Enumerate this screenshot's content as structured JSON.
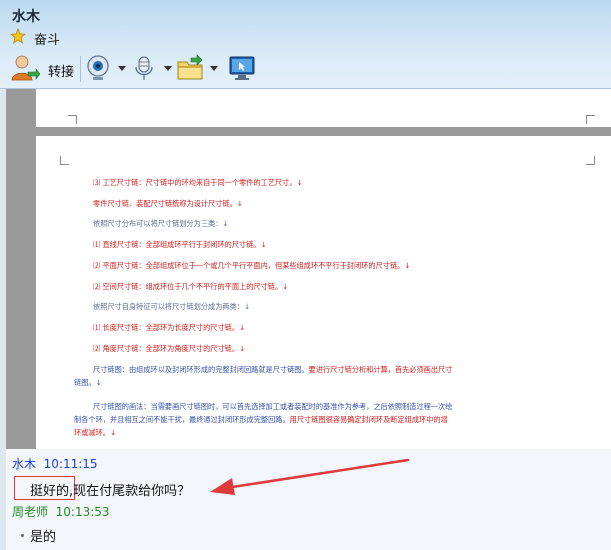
{
  "header": {
    "contact_name": "水木",
    "signature": "奋斗",
    "toolbar": {
      "transfer_label": "转接"
    }
  },
  "document": {
    "lines": [
      {
        "text": "⑶ 工艺尺寸链：尺寸链中的环均来自于同一个零件的工艺尺寸。↓",
        "color": "red"
      },
      {
        "text": "零件尺寸链、装配尺寸链统称为设计尺寸链。↓",
        "color": "red"
      },
      {
        "text": "依照尺寸分布可以将尺寸链划分为三类：↓",
        "color": "gray"
      },
      {
        "text": "⑴ 直线尺寸链：全部组成环平行于封闭环的尺寸链。↓",
        "color": "red"
      },
      {
        "text": "⑵ 平面尺寸链：全部组成环位于一个或几个平行平面内，但某些组成环不平行于封闭环的尺寸链。↓",
        "color": "red"
      },
      {
        "text": "⑵ 空间尺寸链：组成环位于几个不平行的平面上的尺寸链。↓",
        "color": "red"
      },
      {
        "text": "依照尺寸自身特征可以将尺寸链划分成为两类：↓",
        "color": "gray"
      },
      {
        "text": "⑴ 长度尺寸链：全部环为长度尺寸的尺寸链。↓",
        "color": "red"
      },
      {
        "text": "⑵ 角度尺寸链：全部环为角度尺寸的尺寸链。↓",
        "color": "red"
      }
    ],
    "para1": {
      "blue": "尺寸链图：由组成环以及封闭环形成的完整封闭回路就是尺寸链图。",
      "red": "要进行尺寸链分析和计算，首先必须画出尺寸",
      "line2": "链图。↓"
    },
    "para2": {
      "line1": "尺寸链图的画法：当需要画尺寸链图时，可以首先选择加工或者装配时的基准作为参考，之后依照制造过程一次绘",
      "line2_blue": "制各个环，并且相互之间不能干扰，最终通过封闭环形成完整回路。",
      "line2_red": "用尺寸链图很容易确定封闭环及断定组成环中的增",
      "line3": "环或减环。↓"
    }
  },
  "messages": [
    {
      "sender": "水木",
      "time": "10:11:15",
      "highlight": "挺好的",
      "text": ",现在付尾款给你吗？"
    },
    {
      "sender": "周老师",
      "time": "10:13:53",
      "text": "是的"
    }
  ],
  "colors": {
    "doc_red": "#d21d1d",
    "doc_blue": "#3454a8",
    "annotation_red": "#e03a3a",
    "sender_blue": "#1d3fd4",
    "sender_green": "#2a8a2a"
  }
}
